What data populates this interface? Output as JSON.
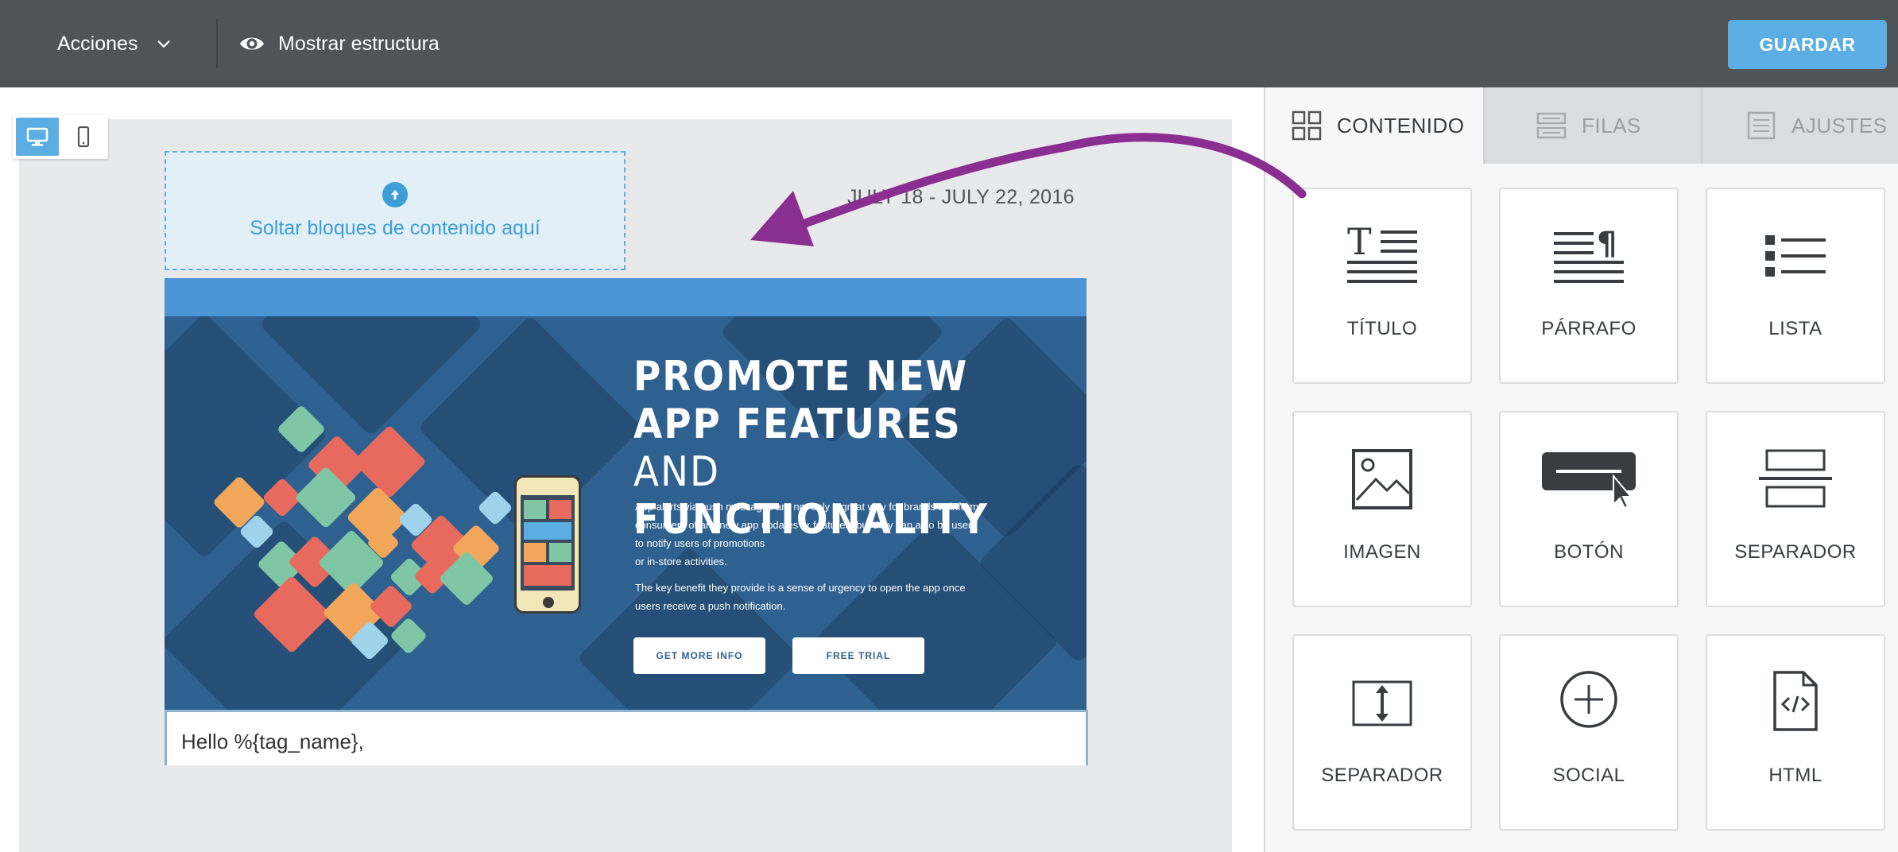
{
  "topbar": {
    "acciones_label": "Acciones",
    "estructura_label": "Mostrar estructura",
    "guardar_label": "GUARDAR"
  },
  "canvas": {
    "dropzone_text": "Soltar bloques de contenido aquí",
    "dateline": "JULY 18 - JULY 22, 2016",
    "hero": {
      "title_line1": "PROMOTE NEW",
      "title_line2": "APP FEATURES",
      "title_line3_thin": "AND ",
      "title_line3_bold": "FUNCTIONALITY",
      "paragraph1": [
        "App alerts via push messages are not only a great way for brands to inform",
        "consumers of any new app updates or features, but they can also be used",
        "to notify users of promotions",
        "or in-store activities."
      ],
      "paragraph2": [
        "The key benefit they provide is a sense of urgency to open the app once",
        "users receive a push notification."
      ],
      "btn_info": "GET MORE INFO",
      "btn_trial": "FREE TRIAL"
    },
    "greeting": "Hello %{tag_name},"
  },
  "panel": {
    "tabs": [
      "CONTENIDO",
      "FILAS",
      "AJUSTES"
    ],
    "blocks": [
      "TÍTULO",
      "PÁRRAFO",
      "LISTA",
      "IMAGEN",
      "BOTÓN",
      "SEPARADOR",
      "SEPARADOR",
      "SOCIAL",
      "HTML"
    ]
  },
  "colors": {
    "topbar": "#505457",
    "accent": "#5aaee3",
    "arrow": "#8b2e91",
    "hero_blue": "#2f6190"
  }
}
